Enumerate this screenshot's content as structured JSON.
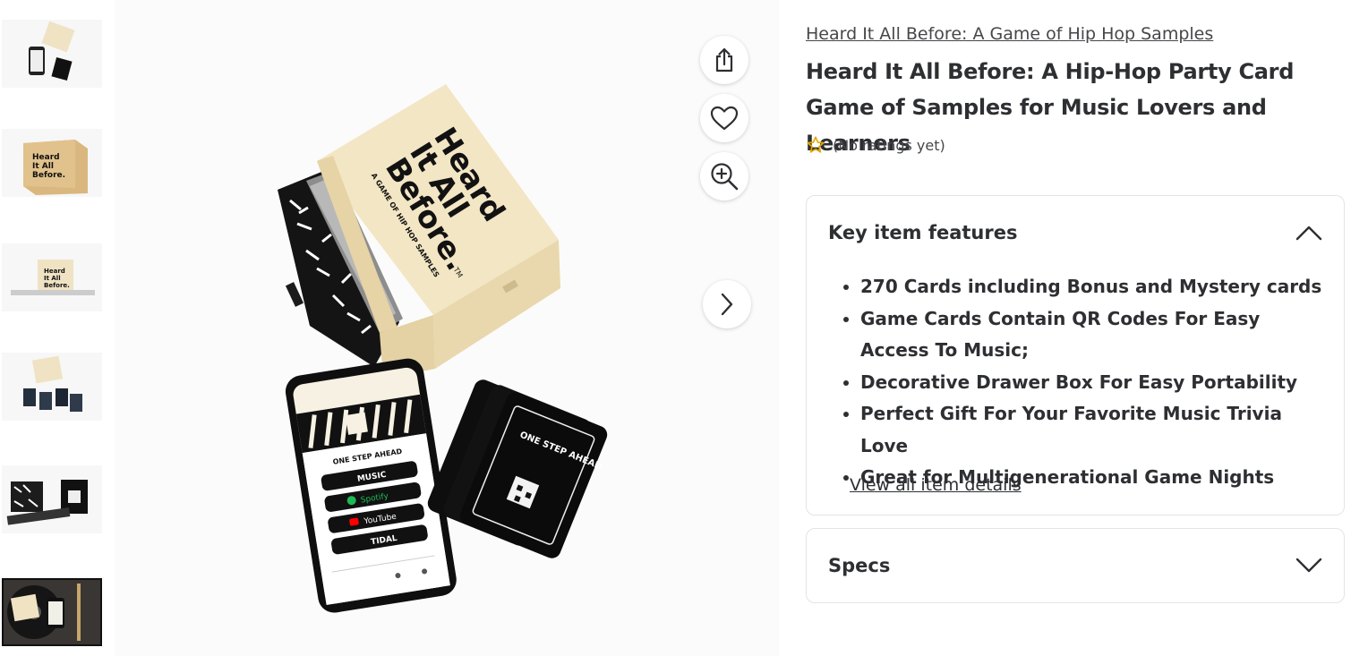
{
  "thumbnails": [
    {
      "label": "thumbnail-1",
      "icon": "box-with-phone-and-cards"
    },
    {
      "label": "thumbnail-2",
      "icon": "box-front"
    },
    {
      "label": "thumbnail-3",
      "icon": "box-side"
    },
    {
      "label": "thumbnail-4",
      "icon": "box-with-cards"
    },
    {
      "label": "thumbnail-5",
      "icon": "decorated-box"
    },
    {
      "label": "thumbnail-6",
      "icon": "turntable-scene"
    }
  ],
  "product_image": {
    "box_text": {
      "line1": "Heard",
      "line2": "It All",
      "line3": "Before.",
      "tagline": "A GAME OF HIP HOP SAMPLES",
      "tm": "TM"
    },
    "phone_text": {
      "heading": "ONE STEP AHEAD",
      "btn1": "MUSIC",
      "btn2": "Spotify",
      "btn3": "YouTube",
      "btn4": "TIDAL"
    },
    "card_text": "ONE STEP AHEAD"
  },
  "actions": {
    "share_icon": "share-icon",
    "favorite_icon": "heart-icon",
    "zoom_icon": "zoom-in-icon",
    "next_icon": "chevron-right-icon"
  },
  "product": {
    "brand_link": "Heard It All Before: A Game of Hip Hop Samples",
    "title": "Heard It All Before: A Hip-Hop Party Card Game of Samples for Music Lovers and Learners",
    "rating_text": "(No ratings yet)",
    "rating_value": 0,
    "rating_color": "#e3a800"
  },
  "features_panel": {
    "title": "Key item features",
    "items": [
      "270 Cards including Bonus and Mystery cards",
      "Game Cards Contain QR Codes For Easy Access To Music;",
      "Decorative Drawer Box For Easy Portability",
      "Perfect Gift For Your Favorite Music Trivia Love",
      "Great for Multigenerational Game Nights"
    ],
    "view_all": "View all item details",
    "expanded": true
  },
  "specs_panel": {
    "title": "Specs",
    "expanded": false
  }
}
